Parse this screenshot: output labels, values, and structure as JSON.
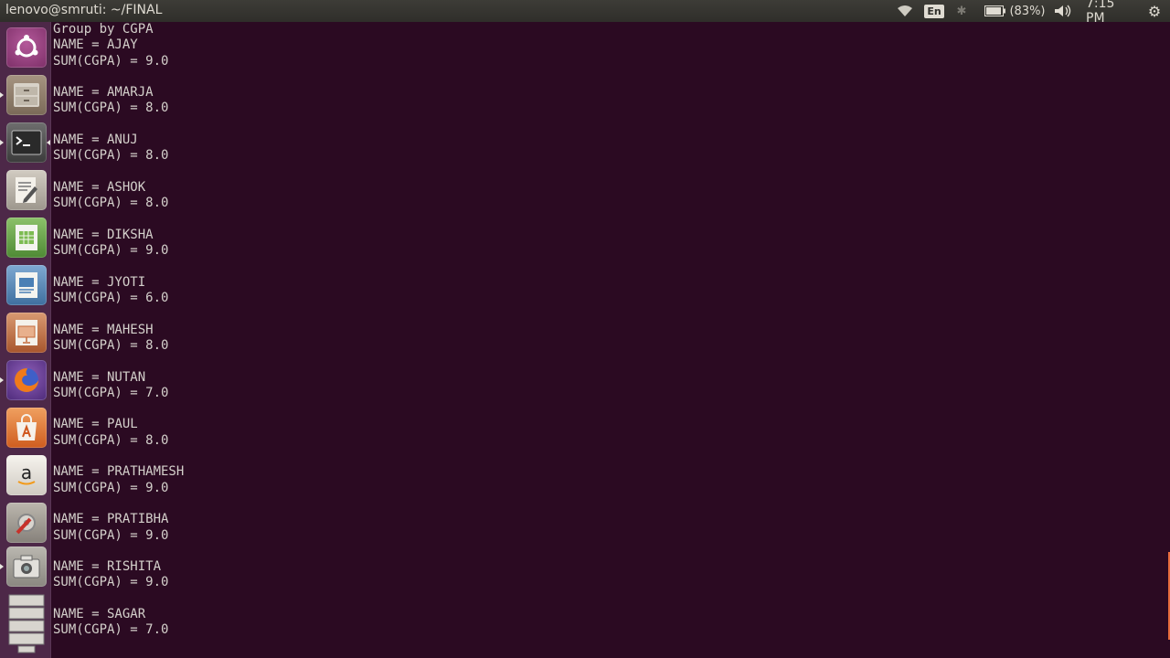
{
  "topbar": {
    "window_title": "lenovo@smruti: ~/FINAL",
    "keyboard_layout": "En",
    "battery_percent": "(83%)",
    "clock": "7:15 PM"
  },
  "launcher": {
    "items": [
      {
        "name": "ubuntu-dash",
        "icon": "ubuntu-logo-icon",
        "color": "#8a3b74"
      },
      {
        "name": "files",
        "icon": "file-cabinet-icon",
        "color": "#8b7c6c"
      },
      {
        "name": "terminal",
        "icon": "terminal-icon",
        "color": "#3a3a3a"
      },
      {
        "name": "text-editor",
        "icon": "text-editor-icon",
        "color": "#b9b3a8"
      },
      {
        "name": "calc",
        "icon": "spreadsheet-icon",
        "color": "#6da34d"
      },
      {
        "name": "writer",
        "icon": "document-icon",
        "color": "#4a7fb5"
      },
      {
        "name": "impress",
        "icon": "presentation-icon",
        "color": "#c46a3b"
      },
      {
        "name": "firefox",
        "icon": "firefox-icon",
        "color": "#e66000"
      },
      {
        "name": "software-center",
        "icon": "shopping-bag-icon",
        "color": "#e2702a"
      },
      {
        "name": "amazon",
        "icon": "amazon-icon",
        "color": "#f0ede7"
      },
      {
        "name": "system-settings",
        "icon": "settings-wrench-icon",
        "color": "#a8a39b"
      },
      {
        "name": "screenshot",
        "icon": "camera-icon",
        "color": "#9b9891"
      },
      {
        "name": "workspaces",
        "icon": "workspaces-icon",
        "color": "#bdbab3"
      }
    ]
  },
  "terminal": {
    "header": "Group by CGPA",
    "records": [
      {
        "name": "NAME = AJAY",
        "sum": "SUM(CGPA) = 9.0"
      },
      {
        "name": "NAME = AMARJA",
        "sum": "SUM(CGPA) = 8.0"
      },
      {
        "name": "NAME = ANUJ",
        "sum": "SUM(CGPA) = 8.0"
      },
      {
        "name": "NAME = ASHOK",
        "sum": "SUM(CGPA) = 8.0"
      },
      {
        "name": "NAME = DIKSHA",
        "sum": "SUM(CGPA) = 9.0"
      },
      {
        "name": "NAME = JYOTI",
        "sum": "SUM(CGPA) = 6.0"
      },
      {
        "name": "NAME = MAHESH",
        "sum": "SUM(CGPA) = 8.0"
      },
      {
        "name": "NAME = NUTAN",
        "sum": "SUM(CGPA) = 7.0"
      },
      {
        "name": "NAME = PAUL",
        "sum": "SUM(CGPA) = 8.0"
      },
      {
        "name": "NAME = PRATHAMESH",
        "sum": "SUM(CGPA) = 9.0"
      },
      {
        "name": "NAME = PRATIBHA",
        "sum": "SUM(CGPA) = 9.0"
      },
      {
        "name": "NAME = RISHITA",
        "sum": "SUM(CGPA) = 9.0"
      },
      {
        "name": "NAME = SAGAR",
        "sum": "SUM(CGPA) = 7.0"
      }
    ]
  },
  "colors": {
    "terminal_bg": "#2b0a22",
    "terminal_fg": "#d4d0cb",
    "panel_bg": "#3a3935",
    "launcher_bg": "#4d2848",
    "scroll_accent": "#e96d3e"
  }
}
